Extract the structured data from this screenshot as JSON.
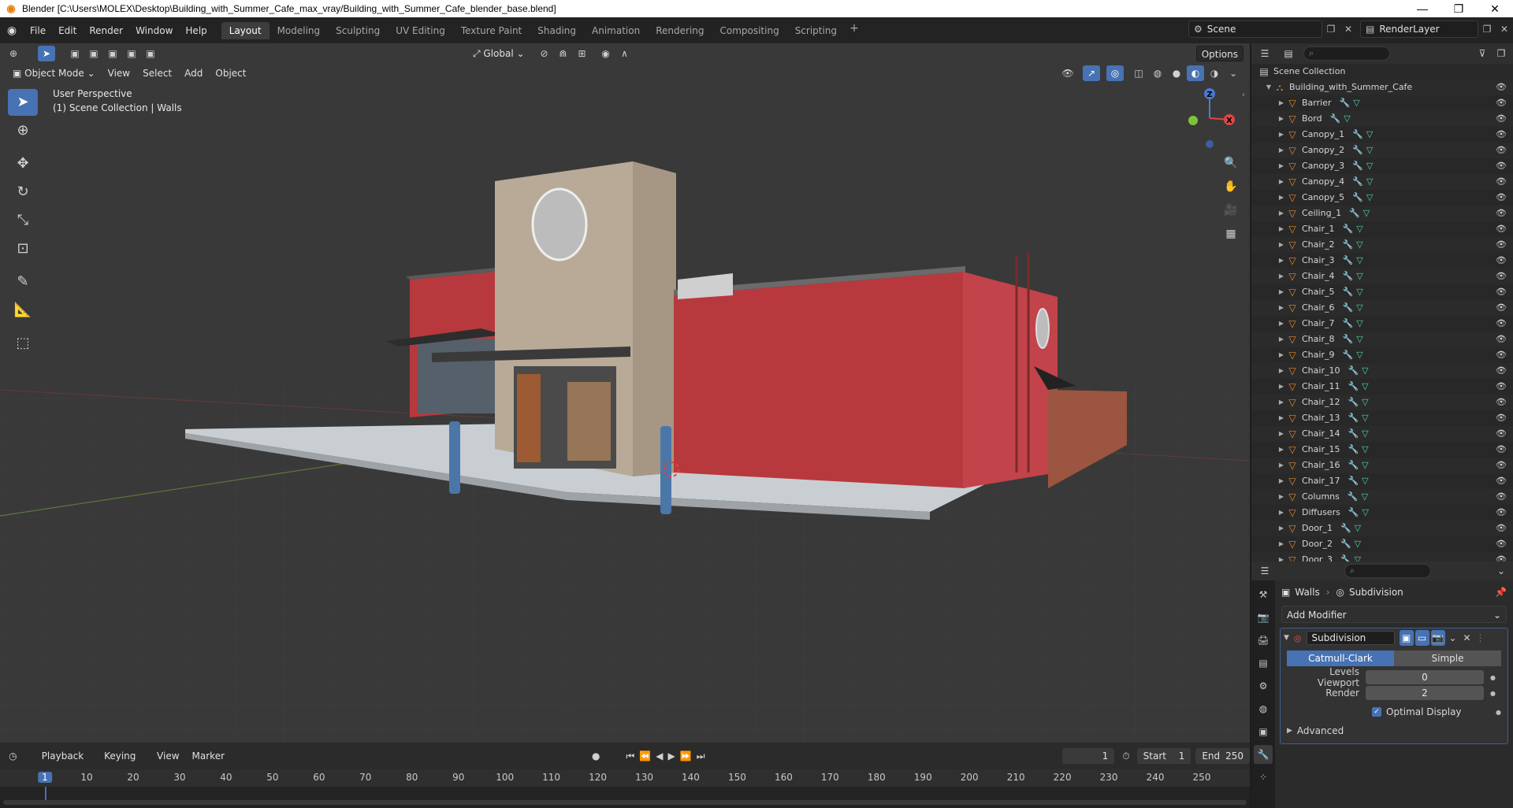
{
  "window": {
    "title": "Blender [C:\\Users\\MOLEX\\Desktop\\Building_with_Summer_Cafe_max_vray/Building_with_Summer_Cafe_blender_base.blend]",
    "minimize": "—",
    "maximize": "❐",
    "close": "✕"
  },
  "menu": [
    "File",
    "Edit",
    "Render",
    "Window",
    "Help"
  ],
  "workspaces": [
    "Layout",
    "Modeling",
    "Sculpting",
    "UV Editing",
    "Texture Paint",
    "Shading",
    "Animation",
    "Rendering",
    "Compositing",
    "Scripting"
  ],
  "scene": {
    "name": "Scene",
    "view_layer": "RenderLayer"
  },
  "viewport": {
    "mode": "Object Mode",
    "menus": [
      "View",
      "Select",
      "Add",
      "Object"
    ],
    "transform_orientation": "Global",
    "options_label": "Options",
    "info_line1": "User Perspective",
    "info_line2": "(1) Scene Collection | Walls",
    "gizmo_z": "Z",
    "gizmo_x": "X"
  },
  "outliner": {
    "root": "Scene Collection",
    "collection": "Building_with_Summer_Cafe",
    "items": [
      "Barrier",
      "Bord",
      "Canopy_1",
      "Canopy_2",
      "Canopy_3",
      "Canopy_4",
      "Canopy_5",
      "Ceiling_1",
      "Chair_1",
      "Chair_2",
      "Chair_3",
      "Chair_4",
      "Chair_5",
      "Chair_6",
      "Chair_7",
      "Chair_8",
      "Chair_9",
      "Chair_10",
      "Chair_11",
      "Chair_12",
      "Chair_13",
      "Chair_14",
      "Chair_15",
      "Chair_16",
      "Chair_17",
      "Columns",
      "Diffusers",
      "Door_1",
      "Door_2",
      "Door_3"
    ]
  },
  "properties": {
    "object": "Walls",
    "modifier_context": "Subdivision",
    "add_modifier": "Add Modifier",
    "modifier_name": "Subdivision",
    "method_options": [
      "Catmull-Clark",
      "Simple"
    ],
    "levels_viewport_label": "Levels Viewport",
    "levels_viewport": "0",
    "render_label": "Render",
    "render_value": "2",
    "optimal_display": "Optimal Display",
    "advanced": "Advanced"
  },
  "timeline": {
    "menus": [
      "Playback",
      "Keying",
      "View",
      "Marker"
    ],
    "current_frame": "1",
    "start_label": "Start",
    "start": "1",
    "end_label": "End",
    "end": "250",
    "ruler": [
      "1",
      "10",
      "20",
      "30",
      "40",
      "50",
      "60",
      "70",
      "80",
      "90",
      "100",
      "110",
      "120",
      "130",
      "140",
      "150",
      "160",
      "170",
      "180",
      "190",
      "200",
      "210",
      "220",
      "230",
      "240",
      "250"
    ]
  },
  "colors": {
    "accent": "#4772b3",
    "wall": "#b8393d",
    "panel": "#282828"
  }
}
